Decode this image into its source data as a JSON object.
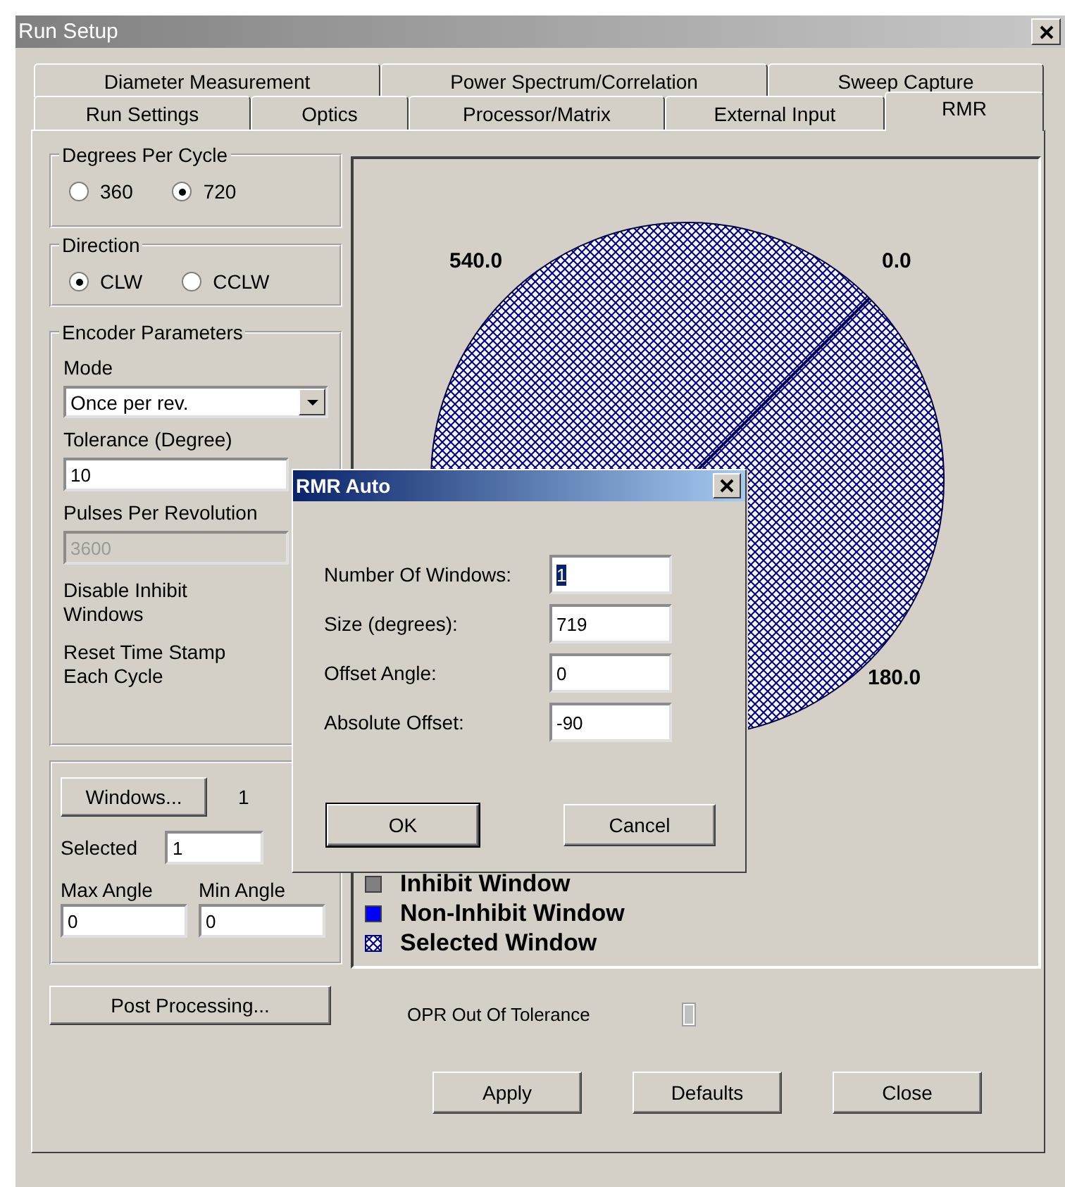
{
  "window": {
    "title": "Run Setup"
  },
  "tab_rows": [
    {
      "tabs": [
        {
          "label": "Diameter Measurement",
          "selected": false
        },
        {
          "label": "Power Spectrum/Correlation",
          "selected": false
        },
        {
          "label": "Sweep Capture",
          "selected": false
        }
      ]
    },
    {
      "tabs": [
        {
          "label": "Run Settings",
          "selected": false
        },
        {
          "label": "Optics",
          "selected": false
        },
        {
          "label": "Processor/Matrix",
          "selected": false
        },
        {
          "label": "External Input",
          "selected": false
        },
        {
          "label": "RMR",
          "selected": true
        }
      ]
    }
  ],
  "degrees_per_cycle": {
    "title": "Degrees Per Cycle",
    "options": [
      {
        "label": "360",
        "selected": false
      },
      {
        "label": "720",
        "selected": true
      }
    ]
  },
  "direction": {
    "title": "Direction",
    "options": [
      {
        "label": "CLW",
        "selected": true
      },
      {
        "label": "CCLW",
        "selected": false
      }
    ]
  },
  "encoder_parameters": {
    "title": "Encoder Parameters",
    "mode": {
      "label": "Mode",
      "value": "Once per rev."
    },
    "tolerance": {
      "label": "Tolerance (Degree)",
      "value": "10"
    },
    "pulses": {
      "label": "Pulses Per Revolution",
      "value": "3600",
      "disabled": true
    },
    "options": [
      "Disable Inhibit Windows",
      "Reset Time Stamp Each Cycle"
    ]
  },
  "windows": {
    "button": "Windows...",
    "count": "1",
    "selected_label": "Selected",
    "selected_value": "1",
    "max_angle": {
      "label": "Max Angle",
      "value": "0"
    },
    "min_angle": {
      "label": "Min Angle",
      "value": "0"
    }
  },
  "post_processing_button": "Post Processing...",
  "disk": {
    "labels": [
      {
        "text": "540.0",
        "kind": "top-left"
      },
      {
        "text": "0.0",
        "kind": "top-right"
      },
      {
        "text": "180.0",
        "kind": "bottom-right"
      }
    ]
  },
  "legend": [
    {
      "label": "Inhibit Window",
      "kind": "solid",
      "color": "#808080"
    },
    {
      "label": "Non-Inhibit Window",
      "kind": "solid",
      "color": "#0000ff"
    },
    {
      "label": "Selected Window",
      "kind": "hatch"
    }
  ],
  "opr": {
    "label": "OPR Out Of Tolerance",
    "on": false
  },
  "buttons": [
    "Apply",
    "Defaults",
    "Close"
  ],
  "dialog": {
    "title": "RMR Auto",
    "fields": [
      {
        "label": "Number Of Windows:",
        "value": "1",
        "highlighted": true
      },
      {
        "label": "Size (degrees):",
        "value": "719",
        "highlighted": false
      },
      {
        "label": "Offset Angle:",
        "value": "0",
        "highlighted": false
      },
      {
        "label": "Absolute Offset:",
        "value": "-90",
        "highlighted": false
      }
    ],
    "buttons": [
      {
        "label": "OK",
        "default": true
      },
      {
        "label": "Cancel",
        "default": false
      }
    ]
  }
}
